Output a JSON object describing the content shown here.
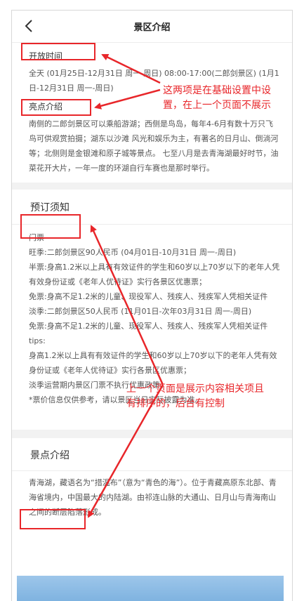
{
  "header": {
    "title": "景区介绍",
    "back_icon": "chevron-left-icon"
  },
  "open_time": {
    "heading": "开放时间",
    "text": "全天 (01月25日-12月31日 周一-周日) 08:00-17:00(二郎剑景区) (1月1日-12月31日 周一-周日)"
  },
  "highlights": {
    "heading": "亮点介绍",
    "text": "南侧的二郎剑景区可以乘船游湖；西侧是鸟岛，每年4-6月有数十万只飞鸟可供观赏拍摄；湖东以沙滩 风光和娱乐为主，有著名的日月山、倒淌河等；北侧则是金银滩和原子城等景点。 七至八月是去青海湖最好时节，油菜花开大片，一年一度的环湖自行车赛也是那时举行。"
  },
  "booking": {
    "heading": "预订须知",
    "lines": [
      "门票",
      "旺季:二郎剑景区90人民币 (04月01日-10月31日 周一-周日)",
      "半票:身高1.2米以上具有有效证件的学生和60岁以上70岁以下的老年人凭有效身份证或《老年人优待证》实行各景区优惠票；",
      "免票:身高不足1.2米的儿童、现役军人、残疾人、残疾军人凭相关证件",
      "淡季:二郎剑景区50人民币 (11月01日-次年03月31日 周一-周日)",
      "免票:身高不足1.2米的儿童、现役军人、残疾人、残疾军人凭相关证件",
      "tips:",
      "身高1.2米以上具有有效证件的学生和60岁以上70岁以下的老年人凭有效身份证或《老年人优待证》实行各景区优惠票；",
      "淡季运营期内景区门票不执行优惠政策。",
      "*票价信息仅供参考，请以景区当日实际披露为准。"
    ]
  },
  "scenic": {
    "heading": "景点介绍",
    "text": "青海湖，藏语名为“措温布”（意为“青色的海”）。位于青藏高原东北部、青海省境内，中国最大的内陆湖。由祁连山脉的大通山、日月山与青海南山之间的断层陷落形成。"
  },
  "annotations": {
    "note1": "这两项是在基础设置中设置，在上一个页面不展示",
    "note2": "上一个页面是展示内容相关项且有排序的，后台有控制",
    "color": "#e8262a"
  }
}
